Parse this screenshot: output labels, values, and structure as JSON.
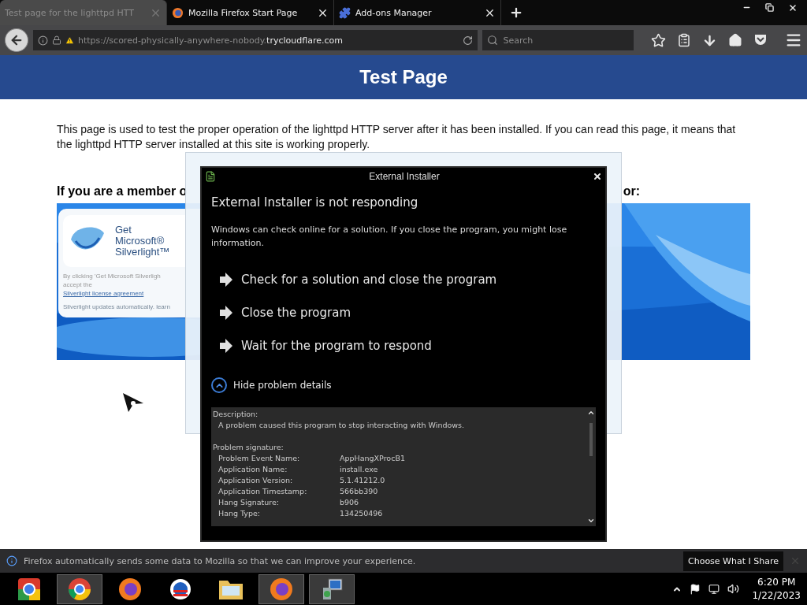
{
  "tabs": [
    {
      "kind": "page",
      "title": "Test page for the lighttpd HTT",
      "selected": true
    },
    {
      "kind": "firefox",
      "title": "Mozilla Firefox Start Page",
      "selected": false
    },
    {
      "kind": "addons",
      "title": "Add-ons Manager",
      "selected": false
    }
  ],
  "address": {
    "prefix": "https://scored-physically-anywhere-nobody.",
    "domain": "trycloudflare.com"
  },
  "search": {
    "placeholder": "Search"
  },
  "page": {
    "title": "Test Page",
    "paragraph": "This page is used to test the proper operation of the lighttpd HTTP server after it has been installed. If you can read this page, it means that the lighttpd HTTP server installed at this site is working properly.",
    "heading_left": "If you are a member o",
    "heading_right": "or:",
    "silverlight": {
      "get": "Get",
      "brand": "Microsoft®",
      "product": "Silverlight™",
      "note": "By clicking 'Get Microsoft Silverligh",
      "accept": "accept the",
      "license": "Silverlight license agreement",
      "updates": "Silverlight updates automatically. learn"
    }
  },
  "dialog": {
    "title": "External Installer",
    "heading": "External Installer is not responding",
    "message": "Windows can check online for a solution. If you close the program, you might lose information.",
    "commands": [
      "Check for a solution and close the program",
      "Close the program",
      "Wait for the program to respond"
    ],
    "details_toggle": {
      "label": "Hide problem details",
      "expanded": true
    },
    "details": {
      "description_label": "Description:",
      "description": "A problem caused this program to stop interacting with Windows.",
      "signature_label": "Problem signature:",
      "rows": [
        {
          "label": "Problem Event Name:",
          "value": "AppHangXProcB1"
        },
        {
          "label": "Application Name:",
          "value": "install.exe"
        },
        {
          "label": "Application Version:",
          "value": "5.1.41212.0"
        },
        {
          "label": "Application Timestamp:",
          "value": "566bb390"
        },
        {
          "label": "Hang Signature:",
          "value": "b906"
        },
        {
          "label": "Hang Type:",
          "value": "134250496"
        }
      ]
    }
  },
  "notification": {
    "message": "Firefox automatically sends some data to Mozilla so that we can improve your experience.",
    "button": "Choose What I Share"
  },
  "taskbar": {
    "apps": [
      {
        "kind": "ring",
        "running": false
      },
      {
        "kind": "chrome",
        "running": true
      },
      {
        "kind": "firefox",
        "running": false
      },
      {
        "kind": "campaign",
        "running": false
      },
      {
        "kind": "folder",
        "running": false
      },
      {
        "kind": "firefox",
        "running": true
      },
      {
        "kind": "installer",
        "running": true
      }
    ],
    "time": "6:20 PM",
    "date": "1/22/2023"
  }
}
